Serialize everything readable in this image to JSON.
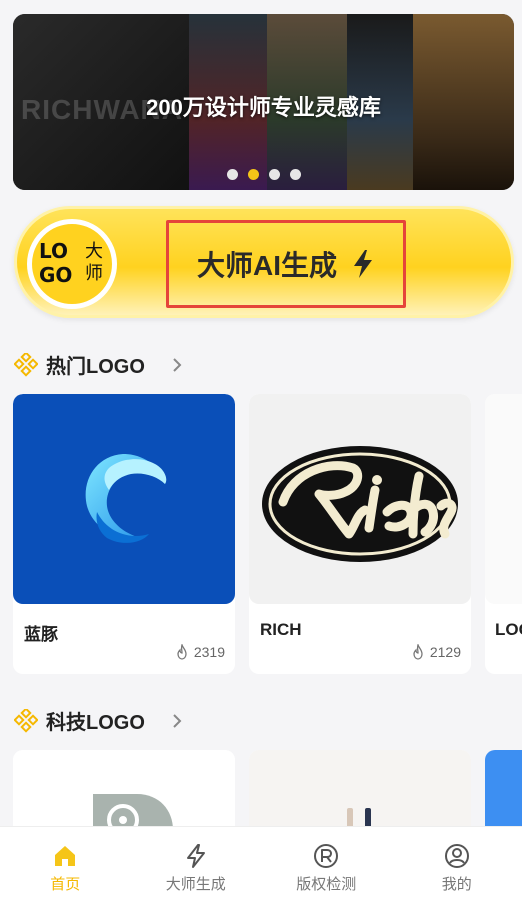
{
  "banner": {
    "title": "200万设计师专业灵感库",
    "ghost_text": "RICHWANA",
    "dots": 4,
    "active_dot": 2
  },
  "ai_generate": {
    "badge_lo": "LO",
    "badge_go": "GO",
    "badge_cn": "大师",
    "label": "大师AI生成",
    "icon": "lightning-icon"
  },
  "sections": [
    {
      "title": "热门LOGO",
      "icon": "diamond-grid-icon",
      "cards": [
        {
          "name": "蓝豚",
          "views": "2319"
        },
        {
          "name": "RICH",
          "views": "2129"
        },
        {
          "name": "LOG"
        }
      ]
    },
    {
      "title": "科技LOGO",
      "icon": "diamond-grid-icon"
    }
  ],
  "tabbar": {
    "items": [
      {
        "label": "首页",
        "icon": "home-icon",
        "active": true
      },
      {
        "label": "大师生成",
        "icon": "lightning-icon",
        "active": false
      },
      {
        "label": "版权检测",
        "icon": "registered-icon",
        "active": false
      },
      {
        "label": "我的",
        "icon": "user-icon",
        "active": false
      }
    ]
  },
  "colors": {
    "accent": "#f5c518",
    "highlight_border": "#e5443a",
    "tab_active": "#f5b800"
  }
}
